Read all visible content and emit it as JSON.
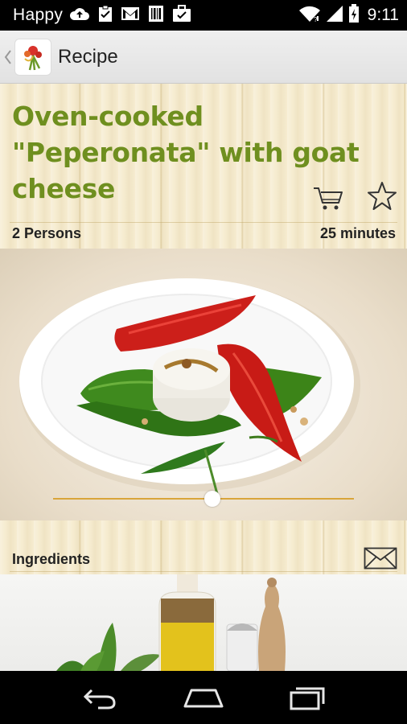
{
  "status_bar": {
    "carrier": "Happy",
    "time": "9:11",
    "icons": [
      "cloud-upload-icon",
      "clipboard-check-icon",
      "gmail-icon",
      "barcode-icon",
      "briefcase-check-icon",
      "wifi-icon",
      "signal-icon",
      "battery-icon"
    ]
  },
  "action_bar": {
    "title": "Recipe",
    "back_icon": "chevron-left-icon",
    "logo_icon": "app-logo-icon"
  },
  "recipe": {
    "title": "Oven-cooked \"Peperonata\" with goat cheese",
    "persons": "2 Persons",
    "duration": "25 minutes",
    "title_color": "#6f8f1f"
  },
  "actions": {
    "cart_icon": "shopping-cart-icon",
    "favorite_icon": "star-outline-icon"
  },
  "photo": {
    "description_icon": "dish-photo",
    "slider_position": 0.53
  },
  "ingredients": {
    "label": "Ingredients",
    "mail_icon": "envelope-icon"
  },
  "nav_bar": {
    "buttons": [
      "back-icon",
      "home-icon",
      "recent-apps-icon"
    ]
  }
}
